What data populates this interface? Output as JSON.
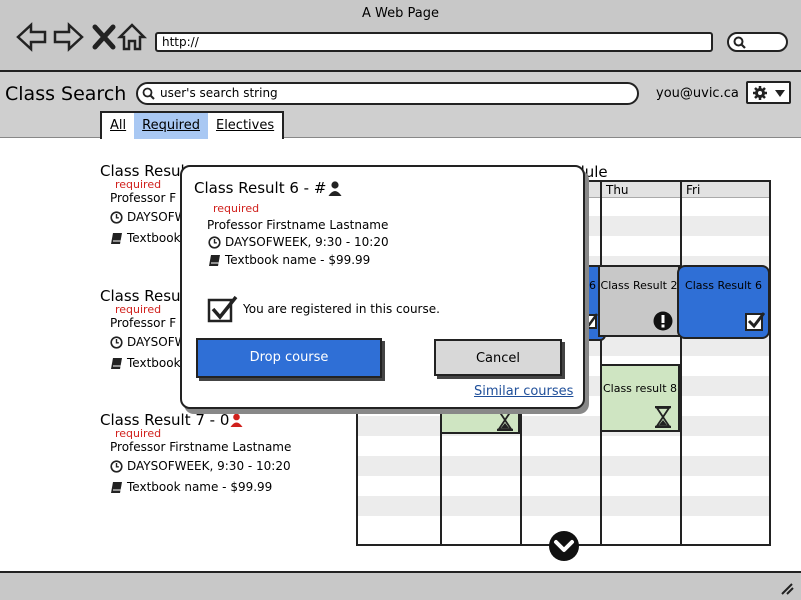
{
  "window": {
    "title": "A Web Page",
    "url": "http://"
  },
  "app": {
    "title": "Class Search",
    "search_value": "user's search string",
    "user": "you@uvic.ca"
  },
  "tabs": [
    {
      "label": "All"
    },
    {
      "label": "Required"
    },
    {
      "label": "Electives"
    }
  ],
  "results": [
    {
      "title": "Class Resul",
      "badge": "required",
      "prof": "Professor F",
      "time": "DAYSOFW",
      "book": "Textbook"
    },
    {
      "title": "Class Resu",
      "badge": "required",
      "prof": "Professor F",
      "time": "DAYSOFW",
      "book": "Textbook"
    },
    {
      "title": "Class Result 7 - 0",
      "badge": "required",
      "prof": "Professor Firstname Lastname",
      "time": "DAYSOFWEEK, 9:30 - 10:20",
      "book": "Textbook name - $99.99"
    }
  ],
  "schedule": {
    "title_fragment": "edule",
    "days": [
      "Thu",
      "Fri"
    ],
    "events": [
      {
        "label": "6"
      },
      {
        "label": "Class Result 2"
      },
      {
        "label": "Class Result 6"
      },
      {
        "label": "Class result 8"
      }
    ]
  },
  "modal": {
    "title": "Class Result 6 - #",
    "badge": "required",
    "prof": "Professor Firstname Lastname",
    "time": "DAYSOFWEEK, 9:30 - 10:20",
    "book": "Textbook name - $99.99",
    "registered_text": "You are registered in this course.",
    "drop_label": "Drop course",
    "cancel_label": "Cancel",
    "similar_label": "Similar courses"
  },
  "colors": {
    "accent": "#2f6fd6",
    "required": "#d0201c",
    "green": "#cfe5c2",
    "grey": "#c8c8c8"
  }
}
